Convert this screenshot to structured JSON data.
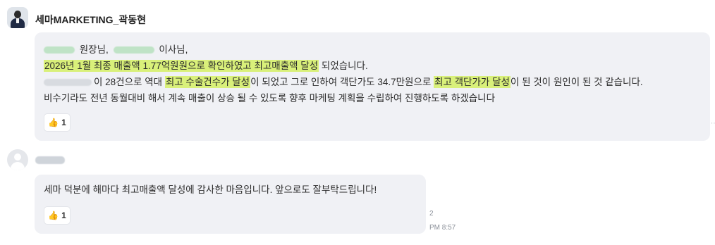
{
  "message1": {
    "sender": "세마MARKETING_곽동현",
    "line1": {
      "suffix1": "원장님,",
      "suffix2": "이사님,"
    },
    "line2": {
      "highlight": "2026년 1월 최종 매출액 1.77억원원으로 확인하였고 최고매출액 달성",
      "rest": "되었습니다."
    },
    "line3": {
      "part1": "이 28건으로 역대",
      "hl1": "최고 수술건수가 달성",
      "part2": "이 되었고 그로 인하여 객단가도 34.7만원으로",
      "hl2": "최고 객단가가 달성",
      "part3": "이 된 것이 원인이 된 것 같습니다."
    },
    "line4": "비수기라도 전년 동월대비 해서 계속 매출이 상승 될 수 있도록 향후 마케팅 계획을 수립하여 진행하도록 하겠습니다",
    "reaction": {
      "icon": "thumbs-up-icon",
      "count": "1"
    }
  },
  "message2": {
    "text": "세마 덕분에 해마다 최고매출액 달성에 감사한 마음입니다. 앞으로도 잘부탁드립니다!",
    "reaction": {
      "icon": "thumbs-up-icon",
      "count": "1"
    },
    "unread": "2",
    "time": "PM 8:57"
  }
}
